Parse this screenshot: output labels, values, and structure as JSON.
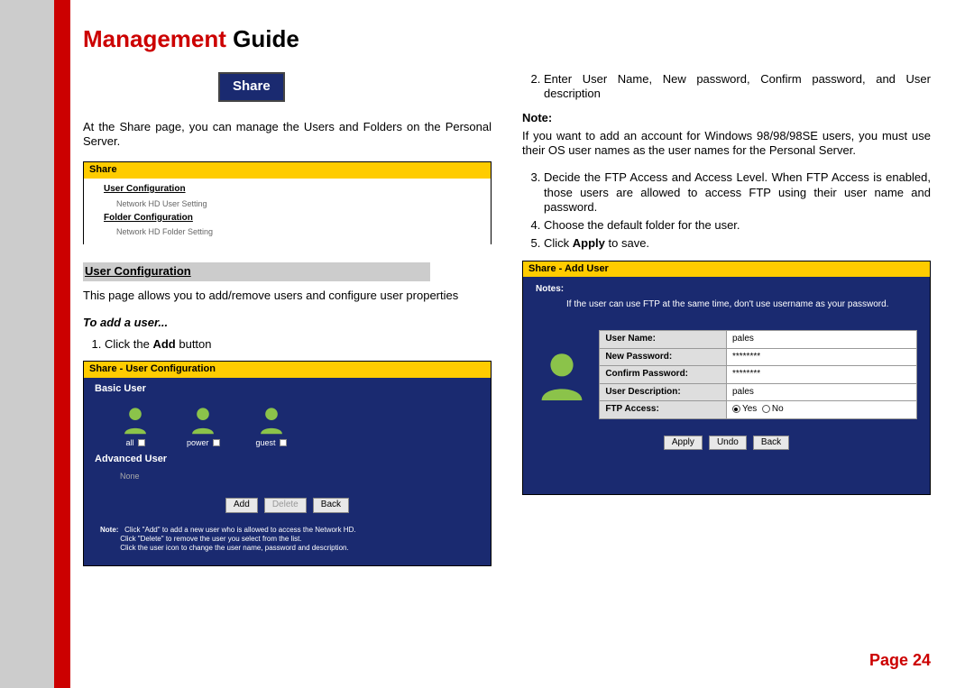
{
  "header": {
    "title_bold": "Management",
    "title_rest": " Guide"
  },
  "page_label": "Page 24",
  "share_chip": "Share",
  "intro": "At the Share page, you can manage the Users and Folders on the Personal Server.",
  "ss1": {
    "title": "Share",
    "link_user": "User Configuration",
    "sub_user": "Network HD User Setting",
    "link_folder": "Folder Configuration",
    "sub_folder": "Network HD Folder Setting"
  },
  "user_config_heading": "User Configuration",
  "user_config_para": "This page allows you to add/remove users and configure user properties",
  "to_add": "To add a user...",
  "step1": "Click the Add button",
  "step1_bold": "Add",
  "ss2": {
    "title": "Share - User Configuration",
    "basic": "Basic User",
    "advanced": "Advanced User",
    "users": [
      "all",
      "power",
      "guest"
    ],
    "none": "None",
    "buttons": {
      "add": "Add",
      "delete": "Delete",
      "back": "Back"
    },
    "note_label": "Note:",
    "note_l1": "Click \"Add\" to add a new user who is allowed to access the Network HD.",
    "note_l2": "Click \"Delete\" to remove the user you select from the list.",
    "note_l3": "Click the user icon to change the user name, password and description."
  },
  "right": {
    "step2": "Enter User Name, New password, Confirm password, and User description",
    "note_heading": "Note:",
    "note_body": "If you want to add an account for Windows 98/98/98SE users, you must use their OS user names as the user names for the Personal Server.",
    "step3": "Decide the FTP Access and Access Level. When FTP Access is enabled, those users are allowed to access FTP using their user name and password.",
    "step4": "Choose the default folder for the user.",
    "step5_pre": "Click ",
    "step5_bold": "Apply",
    "step5_post": " to save."
  },
  "ss3": {
    "title": "Share - Add User",
    "notes_label": "Notes:",
    "notes_body": "If the user can use FTP at the same time, don't use username as your password.",
    "fields": {
      "user_name": {
        "label": "User Name:",
        "value": "pales"
      },
      "new_password": {
        "label": "New Password:",
        "value": "********"
      },
      "confirm_password": {
        "label": "Confirm Password:",
        "value": "********"
      },
      "user_desc": {
        "label": "User Description:",
        "value": "pales"
      },
      "ftp_access": {
        "label": "FTP Access:",
        "yes": "Yes",
        "no": "No"
      }
    },
    "buttons": {
      "apply": "Apply",
      "undo": "Undo",
      "back": "Back"
    }
  }
}
